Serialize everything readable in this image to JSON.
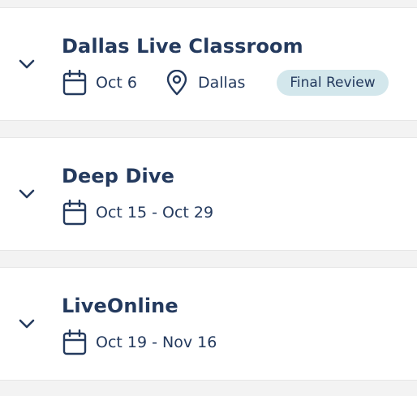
{
  "courses": [
    {
      "title": "Dallas Live Classroom",
      "date": "Oct 6",
      "location": "Dallas",
      "badge": "Final Review"
    },
    {
      "title": "Deep Dive",
      "date": "Oct 15 - Oct 29"
    },
    {
      "title": "LiveOnline",
      "date": "Oct 19 - Nov 16"
    }
  ],
  "icons": {
    "chevron": "chevron-down-icon",
    "calendar": "calendar-icon",
    "location": "map-pin-icon"
  },
  "colors": {
    "text": "#243a5e",
    "badge_bg": "#d3e7ec",
    "page_bg": "#f3f3f3",
    "card_bg": "#ffffff"
  }
}
